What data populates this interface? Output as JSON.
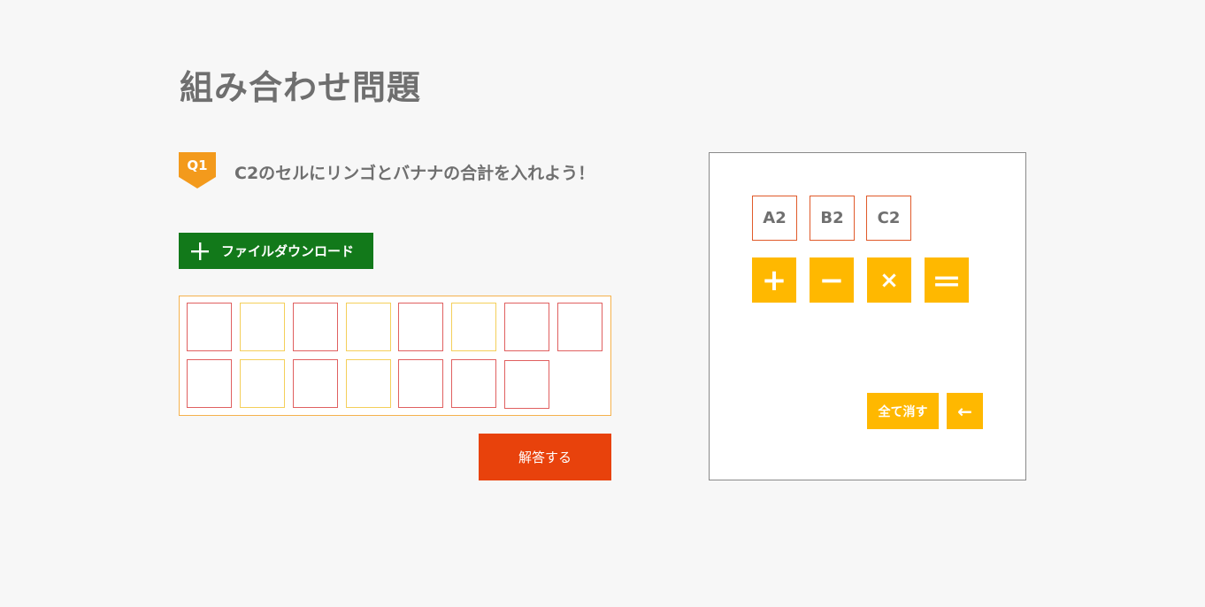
{
  "page": {
    "title": "組み合わせ問題"
  },
  "question": {
    "badge": "Q1",
    "text": "C2のセルにリンゴとバナナの合計を入れよう！"
  },
  "download": {
    "label": "ファイルダウンロード",
    "icon": "plus-icon",
    "color": "#12791a"
  },
  "answer_slots": {
    "row1": [
      "",
      "",
      "",
      "",
      "",
      "",
      "",
      ""
    ],
    "row2": [
      "",
      "",
      "",
      "",
      "",
      "",
      ""
    ]
  },
  "submit": {
    "label": "解答する",
    "color": "#e8420c"
  },
  "formula_panel": {
    "cells": [
      "A2",
      "B2",
      "C2"
    ],
    "operators": [
      "+",
      "−",
      "×",
      "＝"
    ],
    "clear_label": "全て消す",
    "back_label": "←",
    "key_color": "#ffb800"
  }
}
